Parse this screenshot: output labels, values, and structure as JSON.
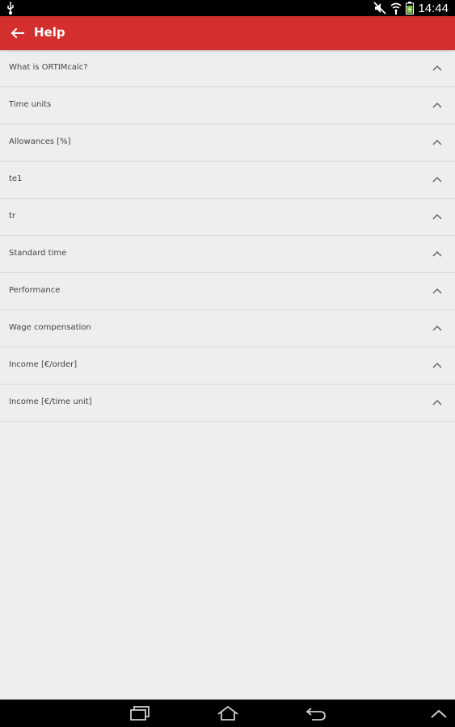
{
  "status_bar": {
    "time": "14:44",
    "icons": [
      "usb-icon",
      "mute-icon",
      "wifi-icon",
      "battery-icon"
    ]
  },
  "app_bar": {
    "title": "Help",
    "back_icon": "arrow-back-icon",
    "color": "#d32f2f"
  },
  "help_items": [
    {
      "label": "What is ORTIMcalc?"
    },
    {
      "label": "Time units"
    },
    {
      "label": "Allowances [%]"
    },
    {
      "label": "te1"
    },
    {
      "label": "tr"
    },
    {
      "label": "Standard time"
    },
    {
      "label": "Performance"
    },
    {
      "label": "Wage compensation"
    },
    {
      "label": "Income [€/order]"
    },
    {
      "label": "Income [€/time unit]"
    }
  ],
  "nav_bar": {
    "icons": [
      "recent-apps-icon",
      "home-icon",
      "back-icon",
      "chevron-up-icon"
    ]
  }
}
